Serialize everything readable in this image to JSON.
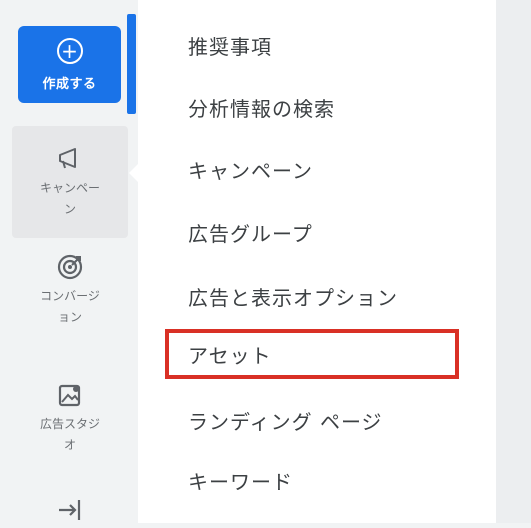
{
  "left_nav": {
    "create_label": "作成する",
    "items": [
      {
        "label_line1": "キャンペー",
        "label_line2": "ン",
        "icon": "megaphone-icon"
      },
      {
        "label_line1": "コンバージ",
        "label_line2": "ョン",
        "icon": "target-icon"
      },
      {
        "label_line1": "広告スタジ",
        "label_line2": "オ",
        "icon": "image-edit-icon"
      },
      {
        "icon": "arrow-right-icon"
      }
    ]
  },
  "menu": {
    "items": [
      {
        "label": "推奨事項"
      },
      {
        "label": "分析情報の検索"
      },
      {
        "label": "キャンペーン"
      },
      {
        "label": "広告グループ"
      },
      {
        "label": "広告と表示オプション"
      },
      {
        "label": "アセット"
      },
      {
        "label": "ランディング ページ"
      },
      {
        "label": "キーワード"
      }
    ]
  },
  "colors": {
    "accent_blue": "#1a73e8",
    "highlight_red": "#d93025"
  }
}
